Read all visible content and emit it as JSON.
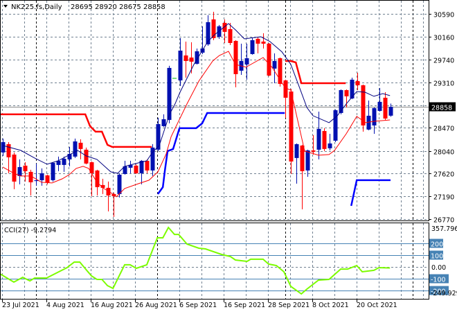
{
  "header": {
    "symbol_timeframe": "NK225.fs,Daily",
    "ohlc": "28695 28920 28675 28858"
  },
  "colors": {
    "bull": "#0010b0",
    "bear": "#ff0000",
    "ma_blue": "#000080",
    "ma_red": "#ff0000",
    "resistance": "#ff0000",
    "support": "#0000ff",
    "cci": "#7cfc00",
    "level_line": "#4682b4",
    "grid": "#708090"
  },
  "chart_data": {
    "type": "candlestick",
    "title": "NK225.fs,Daily",
    "price_axis": {
      "ylim": [
        26770,
        30590
      ],
      "ticks": [
        "30590",
        "30160",
        "29740",
        "29310",
        "28470",
        "28040",
        "27620",
        "27190",
        "26770"
      ],
      "tick_values": [
        30590,
        30160,
        29740,
        29310,
        28470,
        28040,
        27620,
        27190,
        26770
      ],
      "current_price": "28858"
    },
    "x_labels": [
      "23 Jul 2021",
      "4 Aug 2021",
      "16 Aug 2021",
      "26 Aug 2021",
      "6 Sep 2021",
      "16 Sep 2021",
      "28 Sep 2021",
      "8 Oct 2021",
      "20 Oct 2021"
    ],
    "x_label_index": [
      0,
      8,
      16,
      24,
      32,
      40,
      48,
      56,
      64
    ],
    "candles": [
      [
        28010,
        28268,
        27945,
        28203
      ],
      [
        28165,
        28203,
        27623,
        27920
      ],
      [
        27971,
        28010,
        27326,
        27468
      ],
      [
        27571,
        27881,
        27417,
        27739
      ],
      [
        27765,
        27829,
        27468,
        27662
      ],
      [
        27649,
        27688,
        27210,
        27455
      ],
      [
        27478,
        27804,
        27391,
        27493
      ],
      [
        27493,
        27713,
        27391,
        27623
      ],
      [
        27584,
        27597,
        27417,
        27455
      ],
      [
        27494,
        27830,
        27468,
        27817
      ],
      [
        27778,
        27933,
        27662,
        27855
      ],
      [
        27778,
        27933,
        27649,
        27894
      ],
      [
        27881,
        28113,
        27752,
        27984
      ],
      [
        27933,
        28268,
        27907,
        28216
      ],
      [
        28191,
        28255,
        27881,
        28075
      ],
      [
        28062,
        28101,
        27790,
        27804
      ],
      [
        27829,
        27842,
        27197,
        27623
      ],
      [
        27675,
        27688,
        27210,
        27365
      ],
      [
        27404,
        27520,
        27236,
        27352
      ],
      [
        27352,
        27468,
        26914,
        27210
      ],
      [
        27236,
        27262,
        26810,
        27197
      ],
      [
        27236,
        27623,
        27171,
        27597
      ],
      [
        27610,
        27855,
        27597,
        27752
      ],
      [
        27726,
        27855,
        27623,
        27778
      ],
      [
        27765,
        27791,
        27610,
        27623
      ],
      [
        27623,
        27868,
        27417,
        27855
      ],
      [
        27855,
        27881,
        27623,
        27675
      ],
      [
        27675,
        28165,
        27571,
        28101
      ],
      [
        28062,
        28655,
        28036,
        28539
      ],
      [
        28500,
        28720,
        28487,
        28629
      ],
      [
        28616,
        29623,
        28552,
        29584
      ],
      [
        29390,
        29390,
        29390,
        29390
      ],
      [
        29352,
        30139,
        29248,
        29906
      ],
      [
        29816,
        30074,
        29403,
        29713
      ],
      [
        29777,
        30061,
        29481,
        29700
      ],
      [
        29661,
        29945,
        29648,
        29893
      ],
      [
        29868,
        30358,
        29842,
        29945
      ],
      [
        30022,
        30564,
        29997,
        30435
      ],
      [
        30487,
        30629,
        30100,
        30139
      ],
      [
        30164,
        30384,
        30126,
        30358
      ],
      [
        30422,
        30487,
        30048,
        30255
      ],
      [
        30306,
        30422,
        30010,
        30048
      ],
      [
        30087,
        30100,
        29223,
        29468
      ],
      [
        29532,
        30035,
        29455,
        29713
      ],
      [
        29648,
        30035,
        29365,
        29764
      ],
      [
        29842,
        30139,
        29830,
        30100
      ],
      [
        30126,
        30164,
        29855,
        30035
      ],
      [
        30074,
        30229,
        29945,
        30035
      ],
      [
        30035,
        30048,
        29429,
        29442
      ],
      [
        29571,
        29855,
        29300,
        29713
      ],
      [
        29764,
        29777,
        29236,
        29287
      ],
      [
        29352,
        29365,
        28655,
        29029
      ],
      [
        29145,
        29197,
        27610,
        27842
      ],
      [
        27907,
        28178,
        27430,
        28165
      ],
      [
        28139,
        28152,
        26952,
        27662
      ],
      [
        27675,
        28062,
        27558,
        28049
      ],
      [
        28049,
        28333,
        27971,
        28023
      ],
      [
        28062,
        28771,
        27881,
        28449
      ],
      [
        28410,
        28462,
        28036,
        28075
      ],
      [
        28088,
        28358,
        28049,
        28178
      ],
      [
        28229,
        28810,
        28203,
        28797
      ],
      [
        28745,
        29184,
        28720,
        29171
      ],
      [
        29171,
        29184,
        28848,
        29055
      ],
      [
        29016,
        29403,
        29003,
        29365
      ],
      [
        29339,
        29494,
        29171,
        29261
      ],
      [
        29261,
        29274,
        28397,
        28513
      ],
      [
        28436,
        28977,
        28423,
        28694
      ],
      [
        28513,
        28848,
        28358,
        28836
      ],
      [
        28784,
        29210,
        28771,
        28952
      ],
      [
        29029,
        29132,
        28616,
        28642
      ],
      [
        28695,
        28920,
        28675,
        28858
      ]
    ],
    "ma_blue": [
      [
        0,
        28139
      ],
      [
        3.25,
        28049
      ],
      [
        5.75,
        27907
      ],
      [
        8,
        27791
      ],
      [
        10,
        27855
      ],
      [
        13.5,
        28049
      ],
      [
        15.1,
        27945
      ],
      [
        17,
        27881
      ],
      [
        19.5,
        27649
      ],
      [
        20.75,
        27623
      ],
      [
        22,
        27752
      ],
      [
        24,
        27804
      ],
      [
        26,
        27855
      ],
      [
        27,
        28010
      ],
      [
        28.25,
        28139
      ],
      [
        30.1,
        28720
      ],
      [
        31.1,
        28913
      ],
      [
        32,
        29132
      ],
      [
        34.5,
        29648
      ],
      [
        37,
        30074
      ],
      [
        38.25,
        30203
      ],
      [
        40.75,
        30409
      ],
      [
        42,
        30293
      ],
      [
        43.6,
        30126
      ],
      [
        46.6,
        30164
      ],
      [
        48.25,
        30074
      ],
      [
        50.4,
        29881
      ],
      [
        52,
        29648
      ],
      [
        53.6,
        29210
      ],
      [
        54.9,
        28848
      ],
      [
        56,
        28694
      ],
      [
        58.9,
        28565
      ],
      [
        60.4,
        28694
      ],
      [
        62,
        28913
      ],
      [
        63.9,
        29145
      ],
      [
        65.4,
        29132
      ],
      [
        67,
        29055
      ],
      [
        68.6,
        29106
      ],
      [
        69.9,
        29068
      ]
    ],
    "ma_red": [
      [
        0,
        27739
      ],
      [
        2,
        27623
      ],
      [
        3.25,
        27571
      ],
      [
        5.1,
        27571
      ],
      [
        7,
        27455
      ],
      [
        8.9,
        27442
      ],
      [
        10.75,
        27520
      ],
      [
        12,
        27597
      ],
      [
        13.25,
        27713
      ],
      [
        14.5,
        27752
      ],
      [
        15.5,
        27713
      ],
      [
        17,
        27455
      ],
      [
        18.25,
        27339
      ],
      [
        19.5,
        27262
      ],
      [
        20.5,
        27184
      ],
      [
        22,
        27339
      ],
      [
        24.5,
        27430
      ],
      [
        26.4,
        27494
      ],
      [
        28,
        27649
      ],
      [
        29.5,
        27984
      ],
      [
        30.4,
        28307
      ],
      [
        33.25,
        28913
      ],
      [
        35.4,
        29339
      ],
      [
        37.9,
        29713
      ],
      [
        39.1,
        29816
      ],
      [
        40.75,
        29893
      ],
      [
        42,
        29648
      ],
      [
        43.9,
        29597
      ],
      [
        47,
        29777
      ],
      [
        48.6,
        29597
      ],
      [
        51,
        29210
      ],
      [
        52,
        29171
      ],
      [
        54.5,
        28036
      ],
      [
        57,
        27958
      ],
      [
        58.9,
        27971
      ],
      [
        59.9,
        28049
      ],
      [
        62,
        28358
      ],
      [
        63.9,
        28681
      ],
      [
        65.5,
        28565
      ],
      [
        67,
        28590
      ],
      [
        69.9,
        28616
      ]
    ],
    "resistance": [
      [
        [
          -0.5,
          28720
        ],
        [
          14.9,
          28720
        ],
        [
          15.75,
          28500
        ],
        [
          16.75,
          28397
        ],
        [
          17.9,
          28397
        ],
        [
          18.9,
          28152
        ],
        [
          19.75,
          28113
        ],
        [
          26.9,
          28113
        ]
      ],
      [
        [
          51,
          29713
        ],
        [
          52,
          29713
        ],
        [
          52.9,
          29687
        ],
        [
          53.9,
          29300
        ],
        [
          61.9,
          29300
        ]
      ]
    ],
    "support": [
      [
        [
          28,
          27236
        ],
        [
          28.9,
          27365
        ],
        [
          29.25,
          27662
        ],
        [
          29.75,
          28036
        ],
        [
          30.75,
          28075
        ],
        [
          31.9,
          28462
        ],
        [
          34.9,
          28462
        ],
        [
          36,
          28552
        ],
        [
          36.9,
          28745
        ],
        [
          50.9,
          28745
        ]
      ],
      [
        [
          62.9,
          27017
        ],
        [
          63.9,
          27494
        ],
        [
          70,
          27494
        ]
      ]
    ],
    "cci": {
      "label": "CCI(27) -9.2794",
      "ylim": [
        -249.929,
        357.796
      ],
      "top_label": "357.796",
      "bottom_label": "-249.929",
      "levels": [
        200,
        100,
        -100,
        -200
      ],
      "level_labels": [
        "200",
        "100",
        "-100",
        "-200"
      ],
      "zero_label": "0.00",
      "points": [
        [
          -0.5,
          -59
        ],
        [
          2,
          -129
        ],
        [
          3.6,
          -88
        ],
        [
          4.9,
          -118
        ],
        [
          5.75,
          -94
        ],
        [
          7.9,
          -94
        ],
        [
          10.4,
          -35
        ],
        [
          11.6,
          -6
        ],
        [
          12.9,
          41
        ],
        [
          13.9,
          41
        ],
        [
          16,
          -76
        ],
        [
          17,
          -106
        ],
        [
          17.9,
          -106
        ],
        [
          18.9,
          -159
        ],
        [
          19.9,
          -182
        ],
        [
          22,
          18
        ],
        [
          23,
          18
        ],
        [
          24.1,
          -12
        ],
        [
          26,
          18
        ],
        [
          27.9,
          247
        ],
        [
          28.9,
          247
        ],
        [
          29.9,
          335
        ],
        [
          31,
          276
        ],
        [
          31.75,
          276
        ],
        [
          33.25,
          194
        ],
        [
          35.4,
          159
        ],
        [
          36.6,
          153
        ],
        [
          39.5,
          106
        ],
        [
          41.1,
          88
        ],
        [
          42,
          59
        ],
        [
          44.1,
          47
        ],
        [
          44.75,
          65
        ],
        [
          47,
          65
        ],
        [
          48,
          24
        ],
        [
          49.4,
          12
        ],
        [
          50.75,
          -41
        ],
        [
          52,
          -165
        ],
        [
          53.9,
          -229
        ],
        [
          54.9,
          -188
        ],
        [
          57,
          -112
        ],
        [
          58.9,
          -106
        ],
        [
          61,
          -18
        ],
        [
          62.25,
          -18
        ],
        [
          63.9,
          12
        ],
        [
          64.9,
          -41
        ],
        [
          67,
          -29
        ],
        [
          67.9,
          -6
        ],
        [
          69.9,
          -9
        ]
      ]
    }
  }
}
